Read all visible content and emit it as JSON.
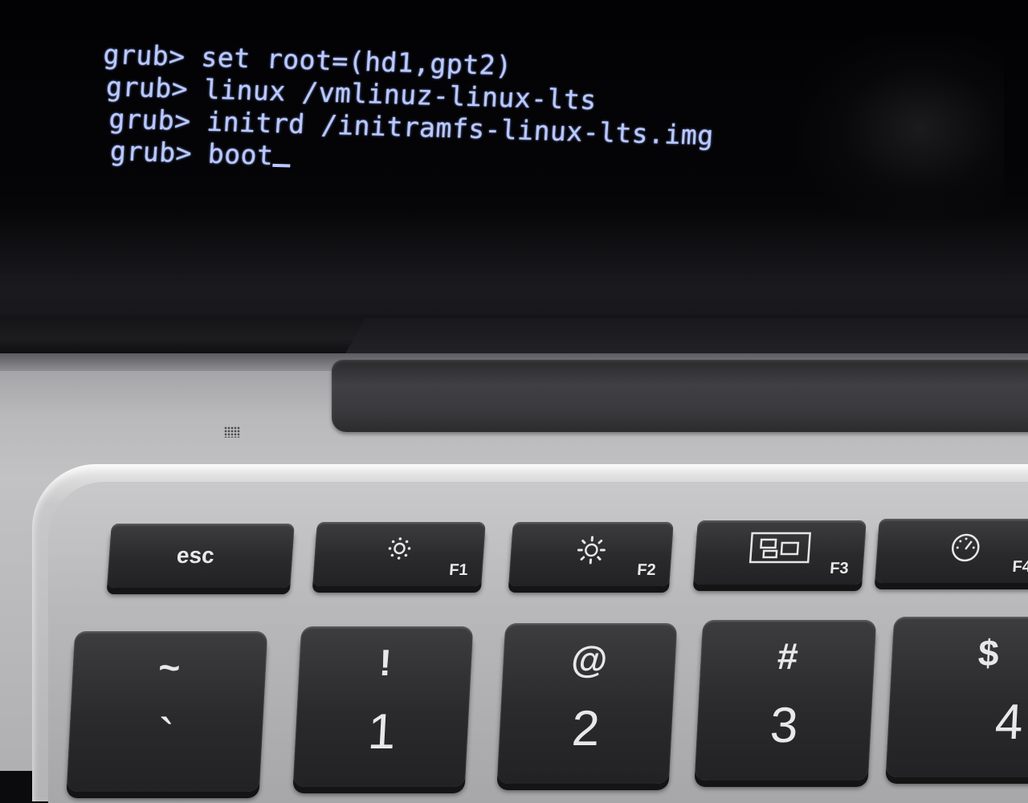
{
  "terminal": {
    "lines": [
      {
        "prompt": "grub>",
        "command": "set root=(hd1,gpt2)"
      },
      {
        "prompt": "grub>",
        "command": "linux /vmlinuz-linux-lts"
      },
      {
        "prompt": "grub>",
        "command": "initrd /initramfs-linux-lts.img"
      },
      {
        "prompt": "grub>",
        "command": "boot"
      }
    ],
    "text_color": "#b9c9ff"
  },
  "keyboard": {
    "function_row": {
      "esc": "esc",
      "f1": {
        "label": "F1",
        "icon": "brightness-down-icon"
      },
      "f2": {
        "label": "F2",
        "icon": "brightness-up-icon"
      },
      "f3": {
        "label": "F3",
        "icon": "mission-control-icon"
      },
      "f4": {
        "label": "F4",
        "icon": "dashboard-icon"
      }
    },
    "number_row": [
      {
        "symbol": "~",
        "main": "`"
      },
      {
        "symbol": "!",
        "main": "1"
      },
      {
        "symbol": "@",
        "main": "2"
      },
      {
        "symbol": "#",
        "main": "3"
      },
      {
        "symbol": "$",
        "main": "4"
      }
    ]
  }
}
